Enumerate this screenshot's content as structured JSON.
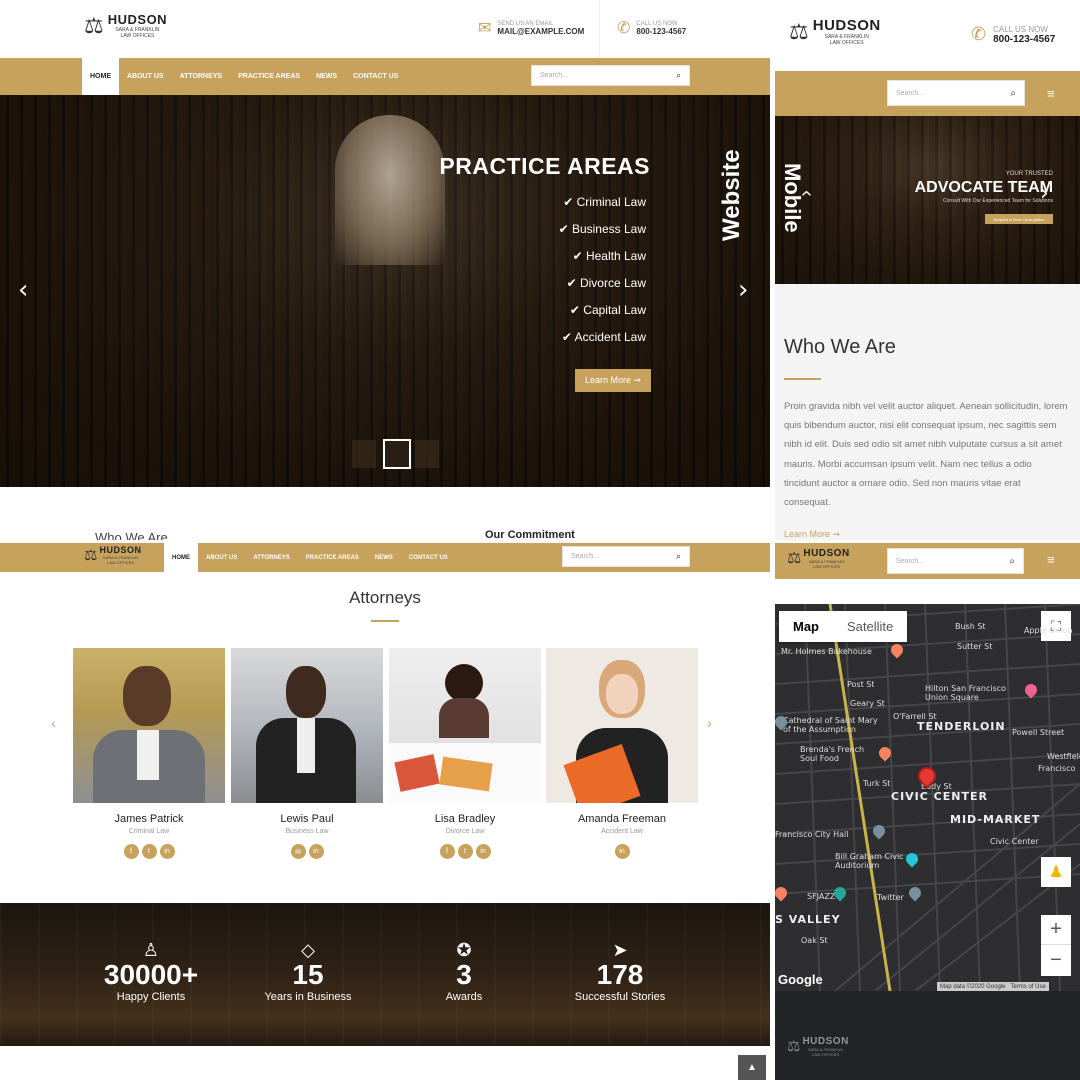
{
  "brand": {
    "name": "HUDSON",
    "sub1": "SARA & FRANKLIN",
    "sub2": "LAW OFFICES"
  },
  "header": {
    "email_caption": "SEND US AN EMAIL",
    "email": "MAIL@EXAMPLE.COM",
    "call_caption": "CALL US NOW",
    "phone": "800-123-4567"
  },
  "nav": {
    "items": [
      "HOME",
      "ABOUT US",
      "ATTORNEYS",
      "PRACTICE AREAS",
      "NEWS",
      "CONTACT US"
    ],
    "search_placeholder": "Search..."
  },
  "hero": {
    "title": "PRACTICE AREAS",
    "items": [
      "Criminal Law",
      "Business Law",
      "Health Law",
      "Divorce Law",
      "Capital Law",
      "Accident Law"
    ],
    "button": "Learn More ➞"
  },
  "labels": {
    "website": "Website",
    "mobile": "Mobile"
  },
  "peek": {
    "who_we_are": "Who We Are",
    "our_commitment": "Our Commitment"
  },
  "mobile": {
    "call_caption": "CALL US NOW",
    "phone": "800-123-4567",
    "search_placeholder": "Search...",
    "hero_kicker": "YOUR TRUSTED",
    "hero_title": "ADVOCATE TEAM",
    "hero_sub": "Consult With Our Experienced Team for Solutions",
    "hero_button": "Request a Free Consultation",
    "who_title": "Who We Are",
    "who_text": "Proin gravida nibh vel velit auctor aliquet. Aenean sollicitudin, lorem quis bibendum auctor, nisi elit consequat ipsum, nec sagittis sem nibh id elit. Duis sed odio sit amet nibh vulputate cursus a sit amet mauris. Morbi accumsan ipsum velit. Nam nec tellus a odio tincidunt auctor a ornare odio. Sed non mauris vitae erat consequat.",
    "learn_more": "Learn More ➞"
  },
  "attorneys": {
    "title": "Attorneys",
    "people": [
      {
        "name": "James Patrick",
        "role": "Criminal Law"
      },
      {
        "name": "Lewis Paul",
        "role": "Business Law"
      },
      {
        "name": "Lisa Bradley",
        "role": "Divorce Law"
      },
      {
        "name": "Amanda Freeman",
        "role": "Accident Law"
      }
    ]
  },
  "stats": [
    {
      "value": "30000+",
      "label": "Happy Clients"
    },
    {
      "value": "15",
      "label": "Years in Business"
    },
    {
      "value": "3",
      "label": "Awards"
    },
    {
      "value": "178",
      "label": "Successful Stories"
    }
  ],
  "map": {
    "tab_map": "Map",
    "tab_satellite": "Satellite",
    "labels": [
      "TENDERLOIN",
      "CIVIC CENTER",
      "MID-MARKET",
      "S VALLEY",
      "Hilton San Francisco Union Square",
      "Cathedral of Saint Mary of the Assumption",
      "Civic Center",
      "Post St",
      "Geary St",
      "O'Farrell St",
      "Turk St",
      "Eddy St",
      "Bush St",
      "Sutter St",
      "Oak St",
      "Powell Street",
      "Apple Union",
      "Mr. Holmes Bakehouse",
      "Francisco City Hall",
      "Bill Graham Civic Auditorium",
      "Brenda's French Soul Food",
      "SFJAZZ",
      "Twitter",
      "Westfield",
      "Francisco"
    ],
    "google": "Google",
    "footer_data": "Map data ©2020 Google",
    "footer_terms": "Terms of Use"
  },
  "colors": {
    "gold": "#c7a25d",
    "dark": "#222222"
  }
}
